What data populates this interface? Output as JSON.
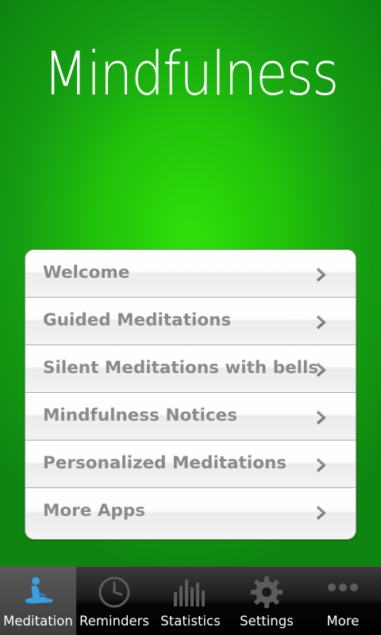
{
  "app": {
    "title": "Mindfulness"
  },
  "menu": {
    "items": [
      {
        "label": "Welcome"
      },
      {
        "label": "Guided Meditations"
      },
      {
        "label": "Silent Meditations with bells"
      },
      {
        "label": "Mindfulness Notices"
      },
      {
        "label": "Personalized Meditations"
      },
      {
        "label": "More Apps"
      }
    ]
  },
  "tabs": [
    {
      "label": "Meditation",
      "icon": "meditation-icon",
      "active": true
    },
    {
      "label": "Reminders",
      "icon": "clock-icon",
      "active": false
    },
    {
      "label": "Statistics",
      "icon": "bar-chart-icon",
      "active": false
    },
    {
      "label": "Settings",
      "icon": "gear-icon",
      "active": false
    },
    {
      "label": "More",
      "icon": "ellipsis-icon",
      "active": false
    }
  ],
  "colors": {
    "background": "#22c40a",
    "menu_text": "#8a8a8a",
    "chevron": "#7a7a7a",
    "tab_active_icon": "#3aa0e0",
    "tab_inactive_icon": "#5a5a5a"
  }
}
